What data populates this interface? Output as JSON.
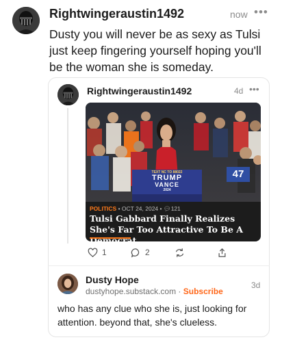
{
  "note": {
    "author": "Rightwingeraustin1492",
    "time": "now",
    "more_icon": "ellipsis-icon",
    "body": "Dusty you will never be as sexy as Tulsi just keep fingering yourself hoping you'll be the woman she is someday."
  },
  "quoted_note": {
    "author": "Rightwingeraustin1492",
    "time": "4d",
    "more_icon": "ellipsis-icon",
    "post": {
      "category": "POLITICS",
      "date": "OCT 24, 2024",
      "comments": "121",
      "title": "Tulsi Gabbard Finally Realizes She's Far Too Attractive To Be A Democrat",
      "podium_sign": {
        "top": "TEXT NC TO 88022",
        "line1": "TRUMP",
        "line2": "VANCE",
        "year": "2024"
      },
      "sign_number": "47"
    },
    "actions": {
      "likes": "1",
      "comments": "2"
    }
  },
  "reply": {
    "author": "Dusty Hope",
    "domain": "dustyhope.substack.com",
    "separator": "·",
    "subscribe_label": "Subscribe",
    "time": "3d",
    "body": "who has any clue who she is, just looking for attention. beyond that, she's clueless."
  },
  "colors": {
    "accent": "#ff6719",
    "card_dark": "#1c1c1c",
    "muted": "#8a8a8a"
  }
}
